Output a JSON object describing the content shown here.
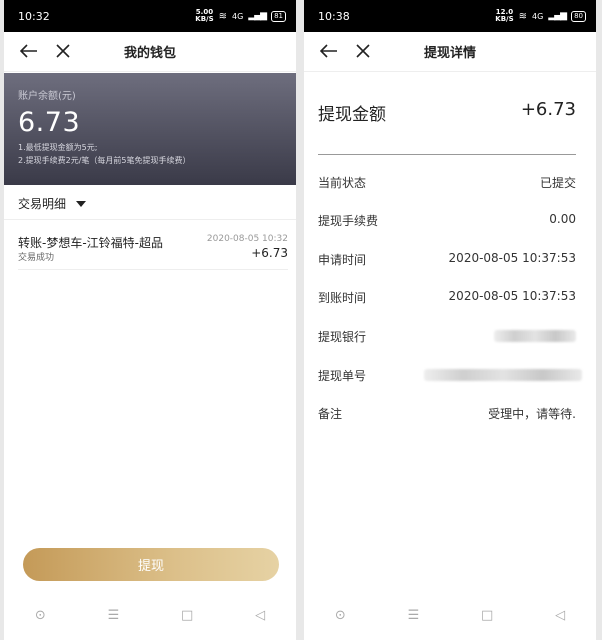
{
  "left": {
    "status": {
      "time": "10:32",
      "speed_top": "5.00",
      "speed_bottom": "KB/S",
      "signal": "4G",
      "battery": "81"
    },
    "nav": {
      "title": "我的钱包"
    },
    "balance": {
      "label": "账户余额(元)",
      "value": "6.73",
      "note1": "1.最低提现金额为5元;",
      "note2": "2.提现手续费2元/笔（每月前5笔免提现手续费）"
    },
    "transactions_header": "交易明细",
    "transactions": [
      {
        "name": "转账-梦想车-江铃福特-超品",
        "status": "交易成功",
        "time": "2020-08-05 10:32",
        "amount": "+6.73"
      }
    ],
    "button": {
      "label": "提现"
    },
    "sysnav": {
      "circle": "⊙",
      "menu": "☰",
      "home": "□",
      "back": "◁"
    }
  },
  "right": {
    "status": {
      "time": "10:38",
      "speed_top": "12.0",
      "speed_bottom": "KB/S",
      "signal": "4G",
      "battery": "80"
    },
    "nav": {
      "title": "提现详情"
    },
    "amount": {
      "label": "提现金额",
      "value": "+6.73"
    },
    "details": {
      "status": {
        "label": "当前状态",
        "value": "已提交"
      },
      "fee": {
        "label": "提现手续费",
        "value": "0.00"
      },
      "apply_time": {
        "label": "申请时间",
        "value": "2020-08-05 10:37:53"
      },
      "arrive_time": {
        "label": "到账时间",
        "value": "2020-08-05 10:37:53"
      },
      "bank": {
        "label": "提现银行"
      },
      "order_no": {
        "label": "提现单号"
      },
      "remark": {
        "label": "备注",
        "value": "受理中，请等待."
      }
    },
    "sysnav": {
      "circle": "⊙",
      "menu": "☰",
      "home": "□",
      "back": "◁"
    }
  }
}
